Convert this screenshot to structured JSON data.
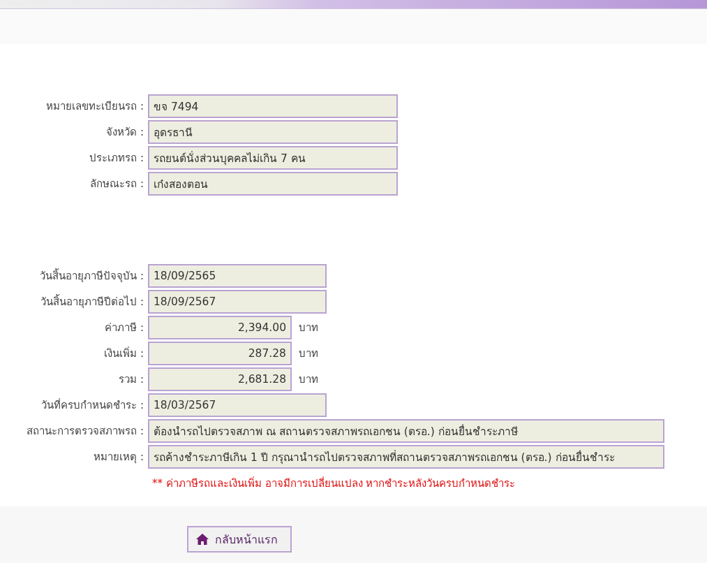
{
  "vehicle": [
    {
      "label": "หมายเลขทะเบียนรถ :",
      "value": "ขจ 7494",
      "kind": "text"
    },
    {
      "label": "จังหวัด :",
      "value": "อุดรธานี",
      "kind": "text"
    },
    {
      "label": "ประเภทรถ :",
      "value": "รถยนต์นั่งส่วนบุคคลไม่เกิน 7 คน",
      "kind": "text"
    },
    {
      "label": "ลักษณะรถ :",
      "value": "เก๋งสองตอน",
      "kind": "text"
    }
  ],
  "tax": [
    {
      "label": "วันสิ้นอายุภาษีปัจจุบัน :",
      "value": "18/09/2565",
      "kind": "date"
    },
    {
      "label": "วันสิ้นอายุภาษีปีต่อไป :",
      "value": "18/09/2567",
      "kind": "date"
    },
    {
      "label": "ค่าภาษี :",
      "value": "2,394.00",
      "kind": "money",
      "unit": "บาท"
    },
    {
      "label": "เงินเพิ่ม :",
      "value": "287.28",
      "kind": "money",
      "unit": "บาท"
    },
    {
      "label": "รวม :",
      "value": "2,681.28",
      "kind": "money",
      "unit": "บาท"
    },
    {
      "label": "วันที่ครบกำหนดชำระ :",
      "value": "18/03/2567",
      "kind": "date"
    },
    {
      "label": "สถานะการตรวจสภาพรถ :",
      "value": "ต้องนำรถไปตรวจสภาพ ณ สถานตรวจสภาพรถเอกชน (ตรอ.) ก่อนยื่นชำระภาษี",
      "kind": "long"
    },
    {
      "label": "หมายเหตุ :",
      "value": "รถค้างชำระภาษีเกิน 1 ปี กรุณานำรถไปตรวจสภาพที่สถานตรวจสภาพรถเอกชน (ตรอ.) ก่อนยื่นชำระ",
      "kind": "long"
    }
  ],
  "warning": "** ค่าภาษีรถและเงินเพิ่ม อาจมีการเปลี่ยนแปลง หากชำระหลังวันครบกำหนดชำระ",
  "home_button": "กลับหน้าแรก"
}
